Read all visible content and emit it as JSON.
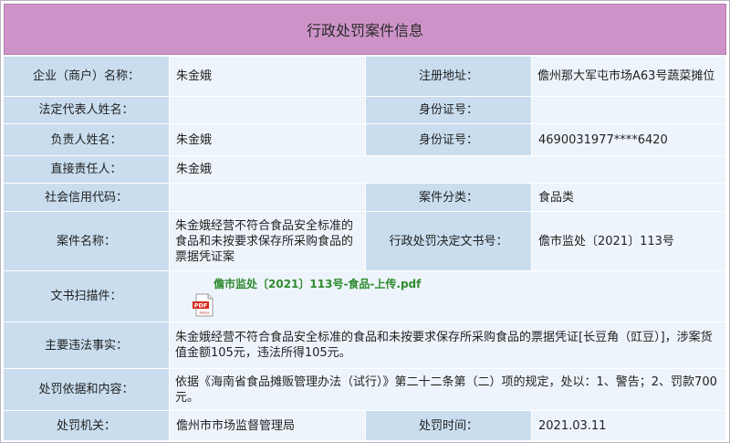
{
  "header": {
    "title": "行政处罚案件信息"
  },
  "fields": {
    "company_name": {
      "label": "企业（商户）名称：",
      "value": "朱金娥"
    },
    "reg_address": {
      "label": "注册地址：",
      "value": "儋州那大军屯市场A63号蔬菜摊位"
    },
    "legal_rep": {
      "label": "法定代表人姓名：",
      "value": ""
    },
    "legal_rep_id": {
      "label": "身份证号：",
      "value": ""
    },
    "person_in_charge": {
      "label": "负责人姓名：",
      "value": "朱金娥"
    },
    "person_in_charge_id": {
      "label": "身份证号：",
      "value": "4690031977****6420"
    },
    "direct_responsible": {
      "label": "直接责任人：",
      "value": "朱金娥"
    },
    "credit_code": {
      "label": "社会信用代码：",
      "value": ""
    },
    "case_category": {
      "label": "案件分类：",
      "value": "食品类"
    },
    "case_name": {
      "label": "案件名称：",
      "value": "朱金娥经营不符合食品安全标准的食品和未按要求保存所采购食品的票据凭证案"
    },
    "decision_doc_no": {
      "label": "行政处罚决定文书号：",
      "value": "儋市监处〔2021〕113号"
    },
    "doc_scan": {
      "label": "文书扫描件：",
      "file_name": "儋市监处〔2021〕113号-食品-上传.pdf",
      "icon": "pdf-file-icon",
      "icon_text": "PDF",
      "icon_subtext": "Adobe"
    },
    "main_facts": {
      "label": "主要违法事实：",
      "value": "朱金娥经营不符合食品安全标准的食品和未按要求保存所采购食品的票据凭证[长豆角（豇豆）]，涉案货值金额105元，违法所得105元。"
    },
    "penalty_basis": {
      "label": "处罚依据和内容：",
      "value": "依据《海南省食品摊贩管理办法（试行）》第二十二条第（二）项的规定，处以：1、警告；2、罚款700元。"
    },
    "penalty_authority": {
      "label": "处罚机关：",
      "value": "儋州市市场监督管理局"
    },
    "penalty_date": {
      "label": "处罚时间：",
      "value": "2021.03.11"
    }
  },
  "colors": {
    "title_bg": "#cd93c8",
    "label_bg": "#c9ddef",
    "value_bg": "#eef4fb",
    "link_green": "#2e8b2e",
    "pdf_red": "#d52b1e"
  }
}
